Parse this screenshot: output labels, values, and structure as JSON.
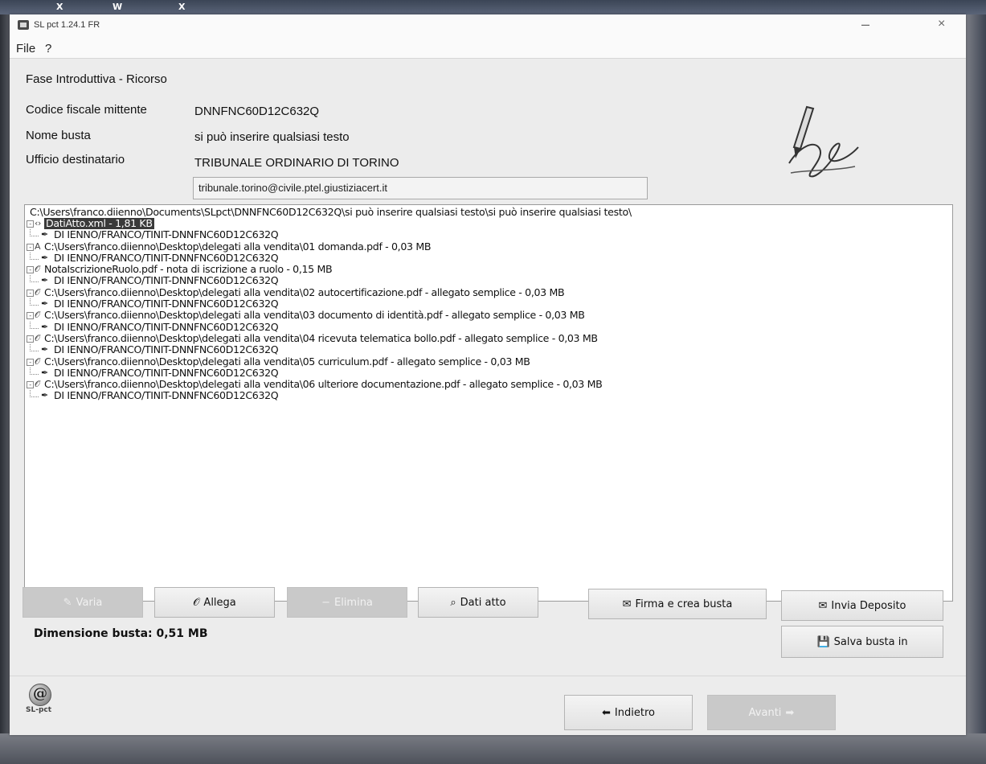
{
  "window": {
    "title": "SL pct 1.24.1 FR",
    "minimize_glyph": "–",
    "close_glyph": "×"
  },
  "menu": {
    "file": "File",
    "help": "?"
  },
  "phase_title": "Fase Introduttiva - Ricorso",
  "form": {
    "codice_fiscale_label": "Codice fiscale mittente",
    "codice_fiscale_value": "DNNFNC60D12C632Q",
    "nome_busta_label": "Nome busta",
    "nome_busta_value": "si può inserire qualsiasi testo",
    "ufficio_label": "Ufficio destinatario",
    "ufficio_value": "TRIBUNALE ORDINARIO DI TORINO",
    "pec_address": "tribunale.torino@civile.ptel.giustiziacert.it"
  },
  "tree": {
    "root_path": "C:\\Users\\franco.diienno\\Documents\\SLpct\\DNNFNC60D12C632Q\\si può inserire qualsiasi testo\\si può inserire qualsiasi testo\\",
    "signer": "DI IENNO/FRANCO/TINIT-DNNFNC60D12C632Q",
    "nodes": [
      {
        "icon": "xml-icon",
        "glyph": "‹›",
        "label": "DatiAtto.xml - 1,81 KB",
        "selected": true
      },
      {
        "icon": "principal-act-icon",
        "glyph": "A",
        "label": "C:\\Users\\franco.diienno\\Desktop\\delegati alla vendita\\01 domanda.pdf - 0,03 MB",
        "selected": false
      },
      {
        "icon": "attachment-icon",
        "glyph": "𝒪",
        "label": "NotaIscrizioneRuolo.pdf - nota di iscrizione a ruolo - 0,15 MB",
        "selected": false
      },
      {
        "icon": "attachment-icon",
        "glyph": "𝒪",
        "label": "C:\\Users\\franco.diienno\\Desktop\\delegati alla vendita\\02 autocertificazione.pdf - allegato semplice - 0,03 MB",
        "selected": false
      },
      {
        "icon": "attachment-icon",
        "glyph": "𝒪",
        "label": "C:\\Users\\franco.diienno\\Desktop\\delegati alla vendita\\03 documento di identità.pdf - allegato semplice - 0,03 MB",
        "selected": false
      },
      {
        "icon": "attachment-icon",
        "glyph": "𝒪",
        "label": "C:\\Users\\franco.diienno\\Desktop\\delegati alla vendita\\04 ricevuta telematica bollo.pdf - allegato semplice - 0,03 MB",
        "selected": false
      },
      {
        "icon": "attachment-icon",
        "glyph": "𝒪",
        "label": "C:\\Users\\franco.diienno\\Desktop\\delegati alla vendita\\05 curriculum.pdf - allegato semplice - 0,03 MB",
        "selected": false
      },
      {
        "icon": "attachment-icon",
        "glyph": "𝒪",
        "label": "C:\\Users\\franco.diienno\\Desktop\\delegati alla vendita\\06 ulteriore documentazione.pdf - allegato semplice - 0,03 MB",
        "selected": false
      }
    ]
  },
  "buttons": {
    "varia": "Varia",
    "allega": "Allega",
    "elimina": "Elimina",
    "dati_atto": "Dati atto",
    "firma": "Firma e crea busta",
    "invia": "Invia Deposito",
    "salva": "Salva busta in",
    "indietro": "Indietro",
    "avanti": "Avanti"
  },
  "dimensione_busta": "Dimensione busta: 0,51 MB",
  "logo_text": "SL-pct",
  "taskbar": [
    "X",
    "W",
    "X"
  ],
  "colors": {
    "selected_bg": "#3a3a3a",
    "disabled_bg": "#c9c9c9",
    "window_bg": "#ececec"
  }
}
